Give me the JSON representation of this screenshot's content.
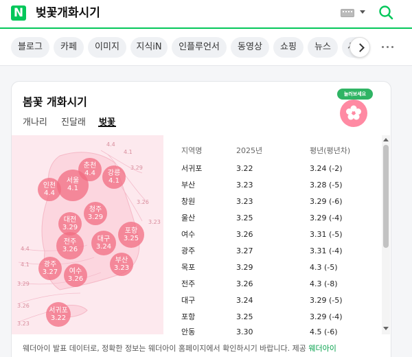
{
  "header": {
    "logo": "N",
    "query": "벚꽃개화시기"
  },
  "tabs": [
    {
      "label": "블로그"
    },
    {
      "label": "카페"
    },
    {
      "label": "이미지"
    },
    {
      "label": "지식iN"
    },
    {
      "label": "인플루언서"
    },
    {
      "label": "동영상"
    },
    {
      "label": "쇼핑"
    },
    {
      "label": "뉴스"
    },
    {
      "label": "서"
    }
  ],
  "card": {
    "title": "봄꽃 개화시기",
    "subtabs": [
      "개나리",
      "진달래",
      "벚꽃"
    ],
    "active_subtab": "벚꽃",
    "badge_label": "눌러보세요",
    "map": {
      "isolines": [
        "4.4",
        "4.1",
        "3.29",
        "3.26",
        "3.23",
        "4.4",
        "4.1",
        "3.29",
        "3.26",
        "3.23"
      ],
      "cities": [
        {
          "name": "춘천",
          "date": "4.4"
        },
        {
          "name": "강릉",
          "date": "4.1"
        },
        {
          "name": "인천",
          "date": "4.4"
        },
        {
          "name": "서울",
          "date": "4.1"
        },
        {
          "name": "청주",
          "date": "3.29"
        },
        {
          "name": "대전",
          "date": "3.29"
        },
        {
          "name": "포항",
          "date": "3.25"
        },
        {
          "name": "전주",
          "date": "3.26"
        },
        {
          "name": "대구",
          "date": "3.24"
        },
        {
          "name": "광주",
          "date": "3.27"
        },
        {
          "name": "여수",
          "date": "3.26"
        },
        {
          "name": "부산",
          "date": "3.23"
        },
        {
          "name": "서귀포",
          "date": "3.22"
        }
      ]
    },
    "table": {
      "headers": [
        "지역명",
        "2025년",
        "평년(평년차)"
      ],
      "rows": [
        {
          "region": "서귀포",
          "y2025": "3.22",
          "normal": "3.24 (-2)"
        },
        {
          "region": "부산",
          "y2025": "3.23",
          "normal": "3.28 (-5)"
        },
        {
          "region": "창원",
          "y2025": "3.23",
          "normal": "3.29 (-6)"
        },
        {
          "region": "울산",
          "y2025": "3.25",
          "normal": "3.29 (-4)"
        },
        {
          "region": "여수",
          "y2025": "3.26",
          "normal": "3.31 (-5)"
        },
        {
          "region": "광주",
          "y2025": "3.27",
          "normal": "3.31 (-4)"
        },
        {
          "region": "목포",
          "y2025": "3.29",
          "normal": "4.3 (-5)"
        },
        {
          "region": "전주",
          "y2025": "3.26",
          "normal": "4.3 (-8)"
        },
        {
          "region": "대구",
          "y2025": "3.24",
          "normal": "3.29 (-5)"
        },
        {
          "region": "포항",
          "y2025": "3.25",
          "normal": "3.29 (-4)"
        },
        {
          "region": "안동",
          "y2025": "3.30",
          "normal": "4.5 (-6)"
        }
      ]
    },
    "footer_text": "웨더아이 발표 데이터로, 정확한 정보는 웨더아이 홈페이지에서 확인하시기 바랍니다. 제공",
    "footer_link": "웨더아이"
  },
  "colors": {
    "brand_green": "#03c75a",
    "blossom_pink": "#f16c82",
    "map_bg": "#fde9ee"
  }
}
